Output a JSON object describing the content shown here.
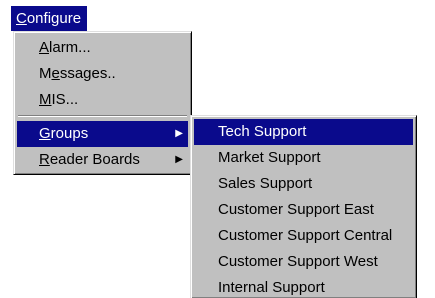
{
  "menubar": {
    "title_first": "C",
    "title_rest": "onfigure"
  },
  "main_menu": {
    "alarm": {
      "first": "A",
      "rest": "larm..."
    },
    "messages": {
      "pre": "M",
      "mid": "e",
      "rest": "ssages.."
    },
    "mis": {
      "first": "M",
      "rest": "IS..."
    },
    "groups": {
      "first": "G",
      "rest": "roups",
      "arrow": "▶"
    },
    "reader_boards": {
      "first": "R",
      "rest": "eader Boards",
      "arrow": "▶"
    }
  },
  "groups_submenu": {
    "items": [
      "Tech Support",
      "Market Support",
      "Sales Support",
      "Customer Support East",
      "Customer Support Central",
      "Customer Support West",
      "Internal Support"
    ]
  },
  "colors": {
    "highlight": "#0a0a8c",
    "menu_face": "#c0c0c0",
    "highlight_text": "#ffffff"
  }
}
